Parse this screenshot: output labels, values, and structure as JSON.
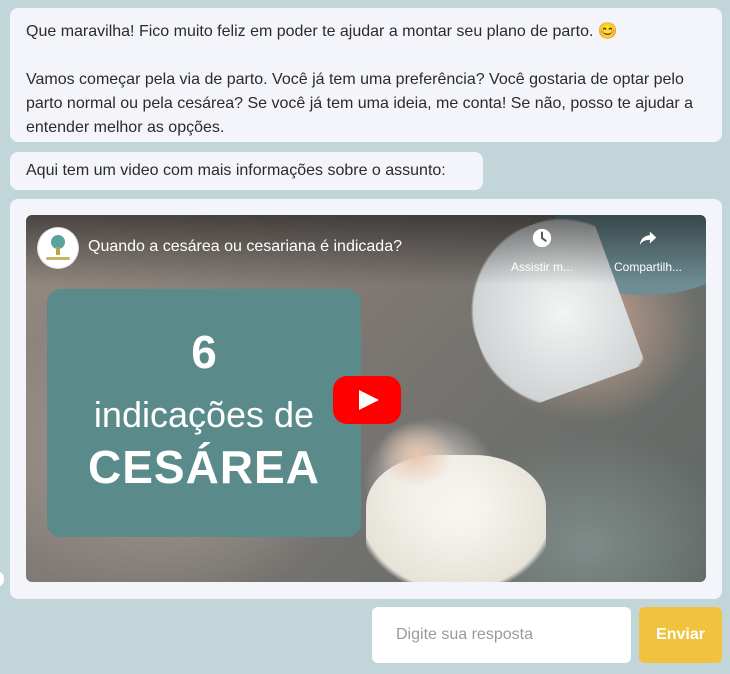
{
  "messages": [
    {
      "paragraphs": [
        "Que maravilha! Fico muito feliz em poder te ajudar a montar seu plano de parto. 😊",
        "Vamos começar pela via de parto. Você já tem uma preferência? Você gostaria de optar pelo parto normal ou pela cesárea? Se você já tem uma ideia, me conta! Se não, posso te ajudar a entender melhor as opções."
      ]
    },
    {
      "text": "Aqui tem um video com mais informações sobre o assunto:"
    }
  ],
  "video": {
    "title": "Quando a cesárea ou cesariana é indicada?",
    "watch_later_label": "Assistir m...",
    "share_label": "Compartilh...",
    "thumbnail": {
      "line1": "6",
      "line2": "indicações de",
      "line3": "CESÁREA"
    },
    "icons": {
      "channel": "channel-logo-icon",
      "watch_later": "clock-icon",
      "share": "share-arrow-icon",
      "play": "youtube-play-icon"
    },
    "colors": {
      "thumbnail_panel": "#5a8a8a",
      "play_button": "#ff0000"
    }
  },
  "input": {
    "placeholder": "Digite sua resposta",
    "value": ""
  },
  "send_button": {
    "label": "Enviar",
    "color": "#f1c23d"
  },
  "background_color": "#c2d6d9"
}
